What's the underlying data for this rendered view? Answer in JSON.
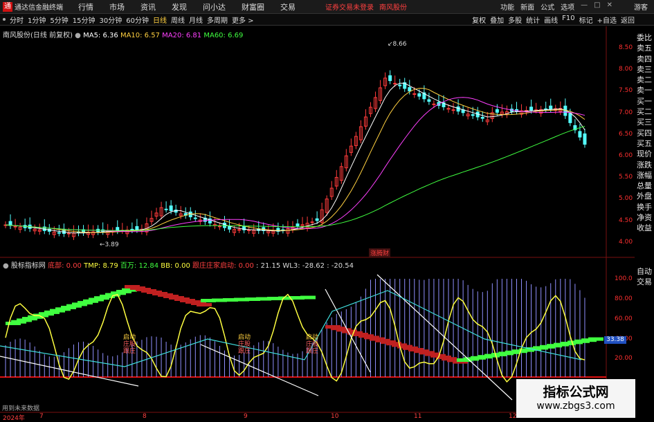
{
  "titlebar": {
    "app": "通达信金融终端",
    "logo": "通",
    "menus": [
      "行情",
      "市场",
      "资讯",
      "发现",
      "问小达",
      "财富圈",
      "交易"
    ],
    "warning": "证券交易未登录",
    "stock": "南风股份",
    "right": [
      "功能",
      "新面",
      "公式",
      "选项"
    ],
    "guest": "游客",
    "window_icons": [
      "minimize-icon",
      "maximize-icon",
      "close-icon"
    ]
  },
  "toolbar": {
    "periods": [
      "分时",
      "1分钟",
      "5分钟",
      "15分钟",
      "30分钟",
      "60分钟",
      "日线",
      "周线",
      "月线",
      "多周期",
      "更多 >"
    ],
    "active_period": "日线",
    "tools": [
      "复权",
      "叠加",
      "多股",
      "统计",
      "画线",
      "F10",
      "标记",
      "+自选",
      "返回"
    ]
  },
  "main_legend": {
    "title": "南风股份(日线 前复权)",
    "ma5": "MA5: 6.36",
    "ma10": "MA10: 6.57",
    "ma20": "MA20: 6.81",
    "ma60": "MA60: 6.69",
    "colors": {
      "ma5": "#ffffff",
      "ma10": "#ffd040",
      "ma20": "#ff40ff",
      "ma60": "#40ff40"
    }
  },
  "price_axis": [
    "8.50",
    "8.00",
    "7.50",
    "7.00",
    "6.50",
    "6.00",
    "5.50",
    "5.00",
    "4.50",
    "4.00"
  ],
  "annotations": {
    "high": "8.66",
    "low": "3.89",
    "badge": "涨腾财"
  },
  "sidebar": [
    "委比",
    "卖五",
    "卖四",
    "卖三",
    "卖二",
    "卖一",
    "买一",
    "买二",
    "买三",
    "买四",
    "买五",
    "现价",
    "涨跌",
    "涨幅",
    "总量",
    "外盘",
    "换手",
    "净资",
    "收益"
  ],
  "sidebar2": [
    "自动",
    "交易"
  ],
  "indicator_legend": {
    "name": "股标指标网",
    "a": "底部: 0.00",
    "tmp": "TMP: 8.79",
    "bw": "百万: 12.84",
    "bb": "BB: 0.00",
    "gz": "跟庄庄家启动: 0.00",
    "v": ": 21.15",
    "wl3": "WL3: -28.62",
    "last": ": -20.54"
  },
  "indicator_axis": [
    "100.0",
    "80.00",
    "60.00",
    "40.00",
    "20.00"
  ],
  "indicator_badge": "33.38",
  "signals": [
    "启动",
    "庄股",
    "跟庄"
  ],
  "bottom_note": "用到未来数据",
  "xaxis": [
    "2024年",
    "7",
    "8",
    "9",
    "10",
    "11",
    "12"
  ],
  "watermark": {
    "title": "指标公式网",
    "url": "www.zbgs3.com"
  }
}
